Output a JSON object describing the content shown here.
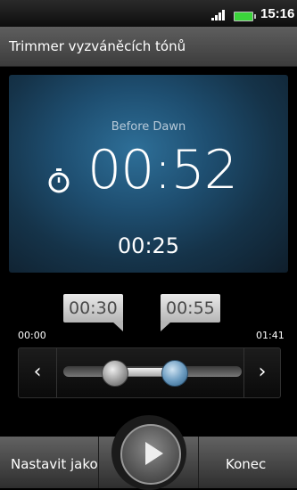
{
  "status_bar": {
    "time": "15:16",
    "signal_icon": "signal-bars-icon",
    "battery_icon": "battery-icon"
  },
  "title_bar": {
    "title": "Trimmer vyzváněcích tónů"
  },
  "player": {
    "song_title": "Before Dawn",
    "current_time": "00:52",
    "clip_length": "00:25",
    "stopwatch_icon": "stopwatch-icon"
  },
  "trim": {
    "start_marker": "00:30",
    "end_marker": "00:55",
    "range_min": "00:00",
    "range_max": "01:41"
  },
  "bottom_bar": {
    "set_as_label": "Nastavit jako",
    "end_label": "Konec",
    "play_icon": "play-icon"
  }
}
